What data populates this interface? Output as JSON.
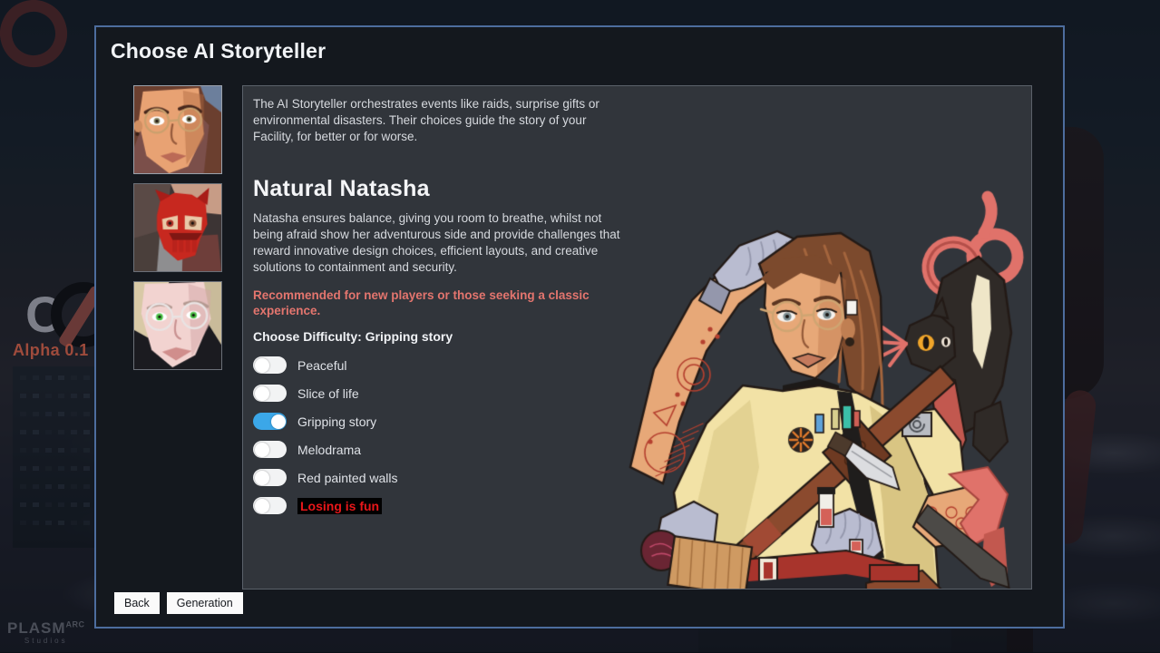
{
  "background": {
    "game_logo_name": "game-logo-icon",
    "version_label": "Alpha 0.1",
    "watermark": {
      "main": "PLASM",
      "superscript": "ARC",
      "sub": "Studios"
    }
  },
  "dialog": {
    "title": "Choose AI Storyteller",
    "intro": "The AI Storyteller orchestrates events like raids, surprise gifts or environmental disasters. Their choices guide the story of your Facility, for better or for worse.",
    "character": {
      "name": "Natural Natasha",
      "description": "Natasha ensures balance, giving you room to breathe, whilst not being afraid show her adventurous side and provide challenges that reward innovative design choices, efficient layouts, and creative solutions to containment and security.",
      "recommendation": "Recommended for new players or those seeking a classic experience."
    },
    "difficulty": {
      "label": "Choose Difficulty: Gripping story",
      "selected": "Gripping story",
      "options": [
        {
          "label": "Peaceful",
          "on": false,
          "danger": false
        },
        {
          "label": "Slice of life",
          "on": false,
          "danger": false
        },
        {
          "label": "Gripping story",
          "on": true,
          "danger": false
        },
        {
          "label": "Melodrama",
          "on": false,
          "danger": false
        },
        {
          "label": "Red painted walls",
          "on": false,
          "danger": false
        },
        {
          "label": "Losing is fun",
          "on": false,
          "danger": true
        }
      ]
    },
    "thumbnails": [
      {
        "name": "storyteller-thumb-natasha",
        "selected": true,
        "alt": "tanned woman with round glasses"
      },
      {
        "name": "storyteller-thumb-skull",
        "selected": false,
        "alt": "red skull mask character"
      },
      {
        "name": "storyteller-thumb-pale",
        "selected": false,
        "alt": "pale woman with green eyes and glasses"
      }
    ],
    "hero_art_alt": "Natasha in lab coat with tattooed arm, machete and tentacled creature",
    "buttons": {
      "back": "Back",
      "generation": "Generation"
    }
  },
  "colors": {
    "accent_blue": "#3ba7e8",
    "dialog_border": "#4d6d9e",
    "dialog_bg": "#14181e",
    "panel_bg": "#31353b",
    "recommend_red": "#e3756e",
    "danger_red": "#e8171a",
    "version_red": "#9e4b3c"
  }
}
